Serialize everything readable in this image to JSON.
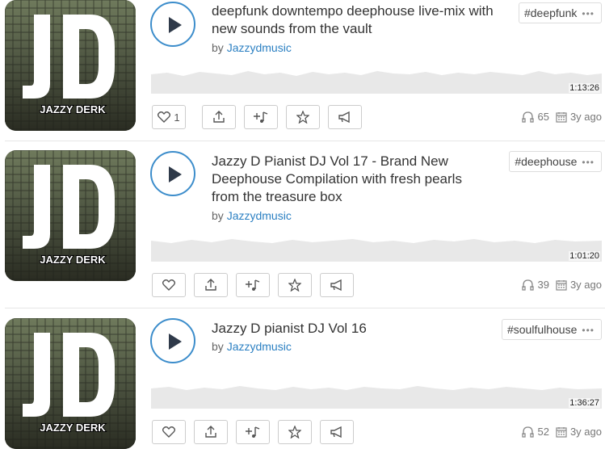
{
  "tracks": [
    {
      "title": "deepfunk downtempo deephouse live-mix with new sounds from the vault",
      "by_prefix": "by",
      "author": "Jazzydmusic",
      "tag": "#deepfunk",
      "duration": "1:13:26",
      "likes": "1",
      "plays": "65",
      "age": "3y ago"
    },
    {
      "title": "Jazzy D Pianist DJ Vol 17 - Brand New Deephouse Compilation with fresh pearls from the treasure box",
      "by_prefix": "by",
      "author": "Jazzydmusic",
      "tag": "#deephouse",
      "duration": "1:01:20",
      "likes": "",
      "plays": "39",
      "age": "3y ago"
    },
    {
      "title": "Jazzy D pianist DJ Vol 16",
      "by_prefix": "by",
      "author": "Jazzydmusic",
      "tag": "#soulfulhouse",
      "duration": "1:36:27",
      "likes": "",
      "plays": "52",
      "age": "3y ago"
    }
  ],
  "cover": {
    "letters": "JD",
    "caption": "JAZZY DERK"
  },
  "colors": {
    "accent": "#3c8dcb",
    "link": "#2a7fc2",
    "wave": "#e8e8e8"
  },
  "icons": {
    "play": "play-icon",
    "like": "heart-icon",
    "repost": "share-icon",
    "add": "add-to-playlist-icon",
    "favorite": "star-icon",
    "promote": "megaphone-icon",
    "plays": "headphones-icon",
    "age": "calendar-icon",
    "more": "more-dots-icon"
  },
  "tag_more": "•••"
}
